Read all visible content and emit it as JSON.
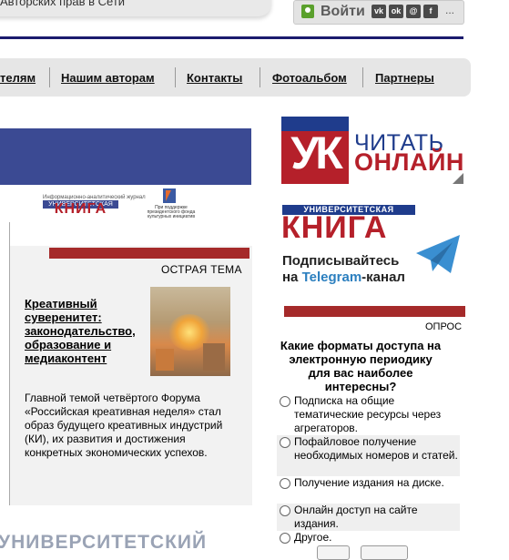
{
  "header": {
    "top_text": "Авторских прав в Сети",
    "login_label": "Войти",
    "social": [
      "vk",
      "ok",
      "@",
      "f"
    ],
    "more": "..."
  },
  "nav": {
    "items": [
      "телям",
      "Нашим авторам",
      "Контакты",
      "Фотоальбом",
      "Партнеры"
    ]
  },
  "partners": {
    "uk_logo_top": "Информационно-аналитический журнал",
    "uk_logo_bar": "УНИВЕРСИТЕТСКАЯ",
    "uk_logo_big": "КНИГА",
    "grant_text": "При поддержке президентского фонда культурных инициатив"
  },
  "article": {
    "section": "ОСТРАЯ ТЕМА",
    "title": "Креативный суверенитет: законодательство, образование и медиаконтент",
    "text": "Главной темой четвёртого Форума «Российская креативная неделя» стал образ будущего креативных индустрий (КИ), их развития и достижения конкретных экономических успехов."
  },
  "bottom_heading": "УНИВЕРСИТЕТСКИЙ",
  "sidebar": {
    "read_online": {
      "mark": "УК",
      "line1": "ЧИТАТЬ",
      "line2": "ОНЛАЙН"
    },
    "telegram": {
      "top": "УНИВЕРСИТЕТСКАЯ",
      "big": "КНИГА",
      "sub1": "Подписывайтесь",
      "sub2_prefix": "на ",
      "sub2_tg": "Telegram",
      "sub2_suffix": "-канал"
    },
    "poll": {
      "label": "ОПРОС",
      "question": "Какие форматы доступа на электронную периодику для вас наиболее интересны?",
      "options": [
        "Подписка на общие тематические ресурсы через агрегаторов.",
        "Пофайловое получение необходимых номеров и статей.",
        "Получение издания на диске.",
        "Онлайн доступ на сайте издания.",
        "Другое."
      ]
    }
  }
}
